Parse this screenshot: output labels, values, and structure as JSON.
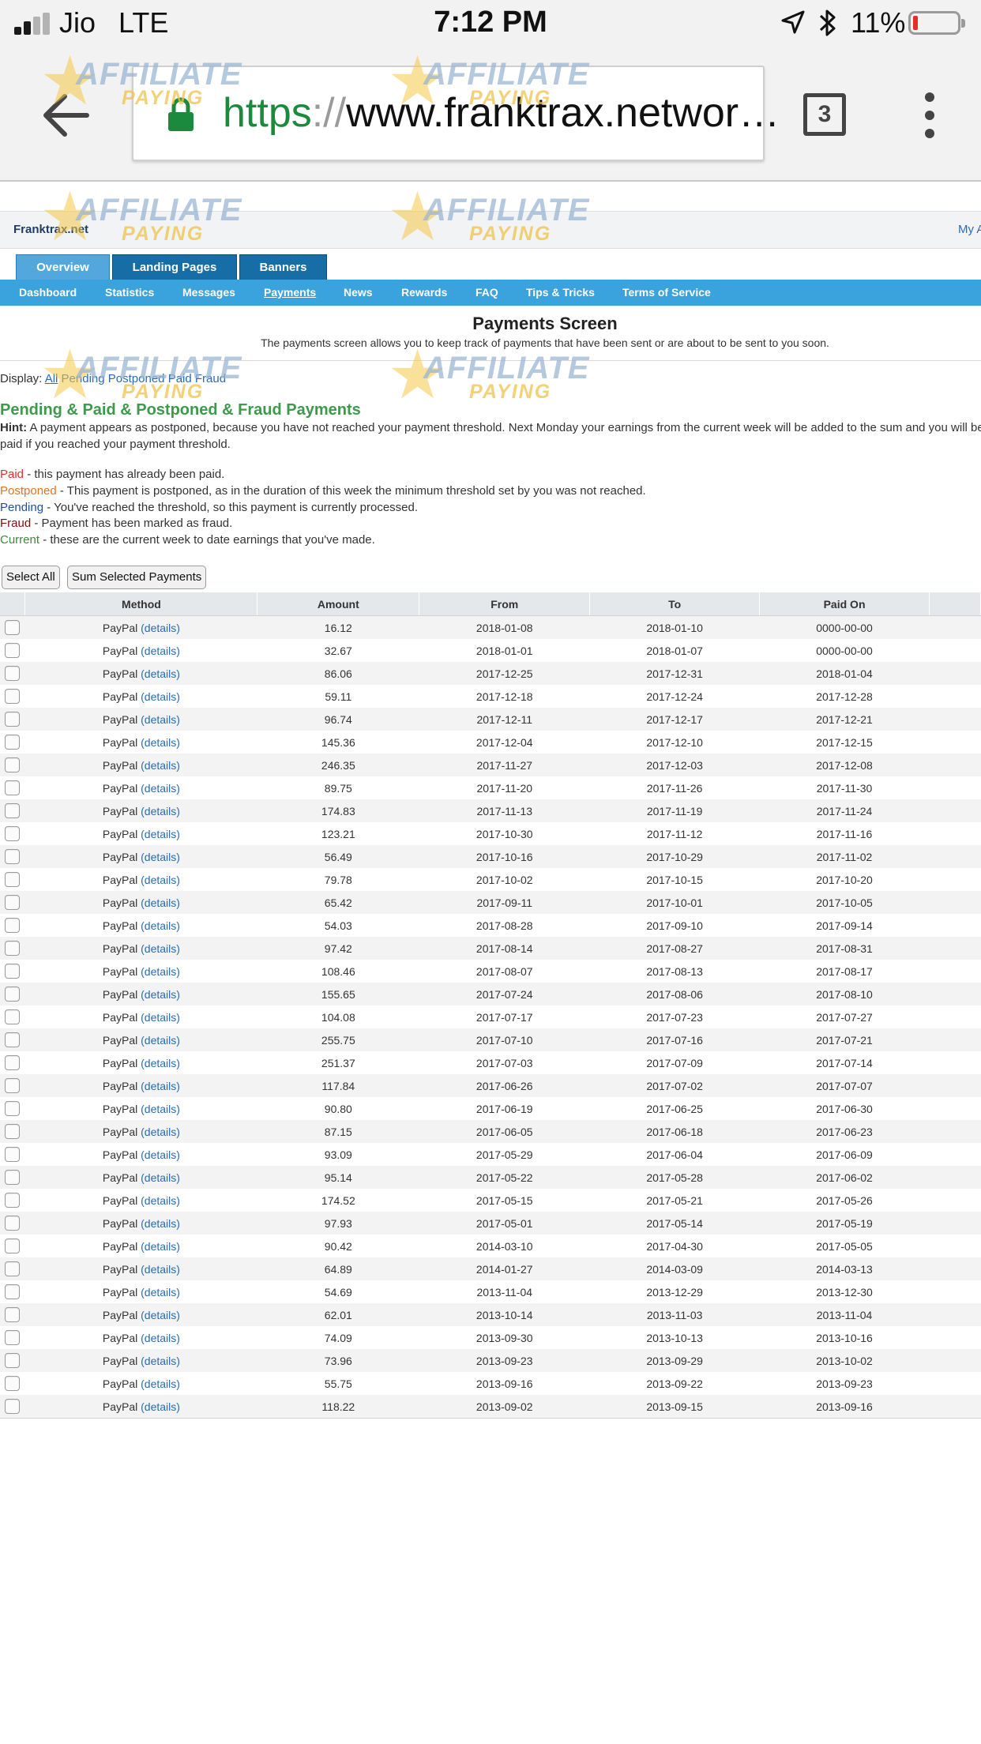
{
  "status_bar": {
    "carrier": "Jio",
    "network": "LTE",
    "time": "7:12 PM",
    "battery_pct": "11%",
    "battery_level": 0.11
  },
  "browser": {
    "url_scheme": "https",
    "url_sep": "://",
    "url_rest": "www.franktrax.networ…",
    "tab_count": "3"
  },
  "watermark": {
    "line1": "AFFILIATE",
    "line2": "PAYING"
  },
  "site": {
    "brand": "Franktrax.net",
    "my_account": "My Account",
    "main_tabs": [
      "Overview",
      "Landing Pages",
      "Banners"
    ],
    "sub_nav": [
      "Dashboard",
      "Statistics",
      "Messages",
      "Payments",
      "News",
      "Rewards",
      "FAQ",
      "Tips & Tricks",
      "Terms of Service"
    ]
  },
  "page": {
    "title": "Payments Screen",
    "description": "The payments screen allows you to keep track of payments that have been sent or are about to be sent to you soon.",
    "display_label": "Display:",
    "display_filters": [
      "All",
      "Pending",
      "Postponed",
      "Paid",
      "Fraud"
    ],
    "section_title": "Pending & Paid & Postponed & Fraud Payments",
    "hint_label": "Hint:",
    "hint_text": "A payment appears as postponed, because you have not reached your payment threshold. Next Monday your earnings from the current week will be added to the sum and you will be paid if you reached your payment threshold.",
    "legend": [
      {
        "term": "Paid",
        "text": " - this payment has already been paid.",
        "color": "#e0302a"
      },
      {
        "term": "Postponed",
        "text": " - This payment is postponed, as in the duration of this week the minimum threshold set by you was not reached.",
        "color": "#e8731e"
      },
      {
        "term": "Pending",
        "text": " - You've reached the threshold, so this payment is currently processed.",
        "color": "#1f4f9a"
      },
      {
        "term": "Fraud",
        "text": " - Payment has been marked as fraud.",
        "color": "#7a1010"
      },
      {
        "term": "Current",
        "text": " - these are the current week to date earnings that you've made.",
        "color": "#3c8a3c"
      }
    ],
    "select_all": "Select All",
    "sum_selected": "Sum Selected Payments"
  },
  "table": {
    "columns": [
      "Method",
      "Amount",
      "From",
      "To",
      "Paid On"
    ],
    "method": "PayPal",
    "details": "(details)",
    "rows": [
      [
        "16.12",
        "2018-01-08",
        "2018-01-10",
        "0000-00-00"
      ],
      [
        "32.67",
        "2018-01-01",
        "2018-01-07",
        "0000-00-00"
      ],
      [
        "86.06",
        "2017-12-25",
        "2017-12-31",
        "2018-01-04"
      ],
      [
        "59.11",
        "2017-12-18",
        "2017-12-24",
        "2017-12-28"
      ],
      [
        "96.74",
        "2017-12-11",
        "2017-12-17",
        "2017-12-21"
      ],
      [
        "145.36",
        "2017-12-04",
        "2017-12-10",
        "2017-12-15"
      ],
      [
        "246.35",
        "2017-11-27",
        "2017-12-03",
        "2017-12-08"
      ],
      [
        "89.75",
        "2017-11-20",
        "2017-11-26",
        "2017-11-30"
      ],
      [
        "174.83",
        "2017-11-13",
        "2017-11-19",
        "2017-11-24"
      ],
      [
        "123.21",
        "2017-10-30",
        "2017-11-12",
        "2017-11-16"
      ],
      [
        "56.49",
        "2017-10-16",
        "2017-10-29",
        "2017-11-02"
      ],
      [
        "79.78",
        "2017-10-02",
        "2017-10-15",
        "2017-10-20"
      ],
      [
        "65.42",
        "2017-09-11",
        "2017-10-01",
        "2017-10-05"
      ],
      [
        "54.03",
        "2017-08-28",
        "2017-09-10",
        "2017-09-14"
      ],
      [
        "97.42",
        "2017-08-14",
        "2017-08-27",
        "2017-08-31"
      ],
      [
        "108.46",
        "2017-08-07",
        "2017-08-13",
        "2017-08-17"
      ],
      [
        "155.65",
        "2017-07-24",
        "2017-08-06",
        "2017-08-10"
      ],
      [
        "104.08",
        "2017-07-17",
        "2017-07-23",
        "2017-07-27"
      ],
      [
        "255.75",
        "2017-07-10",
        "2017-07-16",
        "2017-07-21"
      ],
      [
        "251.37",
        "2017-07-03",
        "2017-07-09",
        "2017-07-14"
      ],
      [
        "117.84",
        "2017-06-26",
        "2017-07-02",
        "2017-07-07"
      ],
      [
        "90.80",
        "2017-06-19",
        "2017-06-25",
        "2017-06-30"
      ],
      [
        "87.15",
        "2017-06-05",
        "2017-06-18",
        "2017-06-23"
      ],
      [
        "93.09",
        "2017-05-29",
        "2017-06-04",
        "2017-06-09"
      ],
      [
        "95.14",
        "2017-05-22",
        "2017-05-28",
        "2017-06-02"
      ],
      [
        "174.52",
        "2017-05-15",
        "2017-05-21",
        "2017-05-26"
      ],
      [
        "97.93",
        "2017-05-01",
        "2017-05-14",
        "2017-05-19"
      ],
      [
        "90.42",
        "2014-03-10",
        "2017-04-30",
        "2017-05-05"
      ],
      [
        "64.89",
        "2014-01-27",
        "2014-03-09",
        "2014-03-13"
      ],
      [
        "54.69",
        "2013-11-04",
        "2013-12-29",
        "2013-12-30"
      ],
      [
        "62.01",
        "2013-10-14",
        "2013-11-03",
        "2013-11-04"
      ],
      [
        "74.09",
        "2013-09-30",
        "2013-10-13",
        "2013-10-16"
      ],
      [
        "73.96",
        "2013-09-23",
        "2013-09-29",
        "2013-10-02"
      ],
      [
        "55.75",
        "2013-09-16",
        "2013-09-22",
        "2013-09-23"
      ],
      [
        "118.22",
        "2013-09-02",
        "2013-09-15",
        "2013-09-16"
      ]
    ]
  },
  "colors": {
    "accent": "#3aa3dd",
    "tab": "#176ea6",
    "tab_active": "#52a8dc",
    "link": "#2a6bb3",
    "section_title": "#3c9a4a",
    "url_scheme": "#1c8a3c"
  },
  "icons": {
    "back": "back-arrow-icon",
    "lock": "lock-icon",
    "tabs": "tab-switcher-icon",
    "menu": "more-vert-icon",
    "location": "location-arrow-icon",
    "bluetooth": "bluetooth-icon",
    "battery": "battery-icon",
    "signal": "signal-icon"
  }
}
